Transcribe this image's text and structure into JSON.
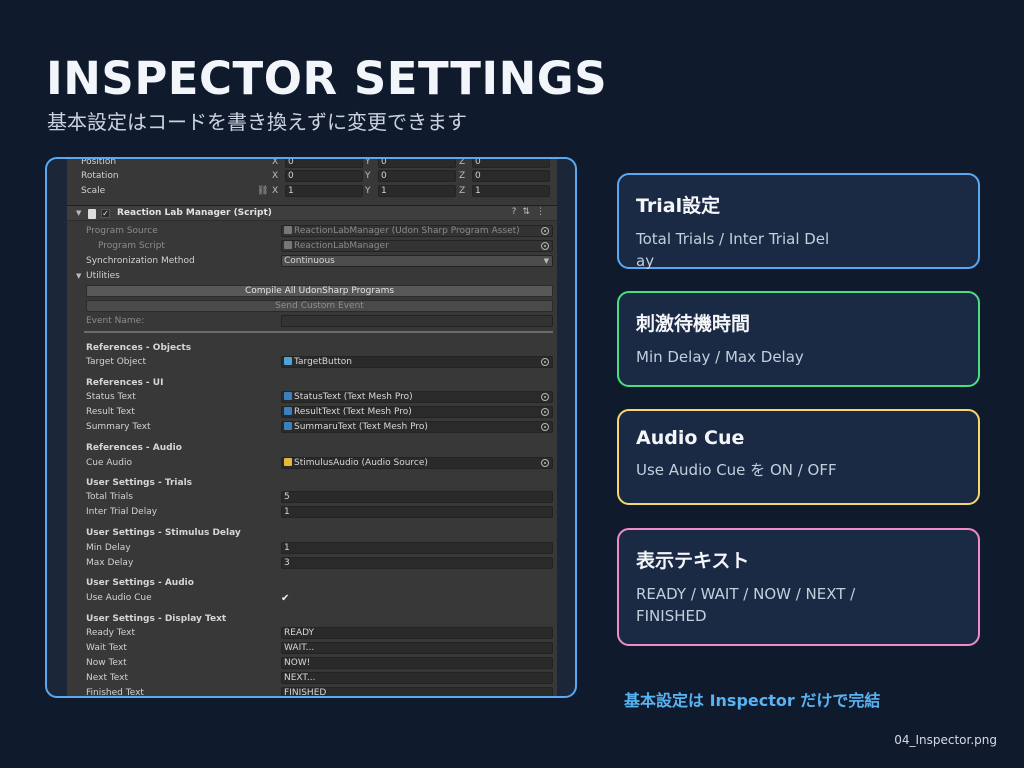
{
  "slide": {
    "title": "INSPECTOR SETTINGS",
    "subtitle": "基本設定はコードを書き換えずに変更できます",
    "footer_note": "基本設定は Inspector だけで完結",
    "file_name": "04_Inspector.png"
  },
  "colors": {
    "background": "#0f1b2d",
    "frame_border": "#5aa9f0",
    "card_trial": "#5aa9f0",
    "card_delay": "#4ade80",
    "card_audio": "#f5d76e",
    "card_text": "#f08cc8",
    "accent_text": "#59b2f2"
  },
  "inspector": {
    "transform": {
      "position_label": "Position",
      "rotation_label": "Rotation",
      "scale_label": "Scale",
      "axis_x": "X",
      "axis_y": "Y",
      "axis_z": "Z",
      "position": [
        "0",
        "0",
        "0"
      ],
      "rotation": [
        "0",
        "0",
        "0"
      ],
      "scale": [
        "1",
        "1",
        "1"
      ]
    },
    "component": {
      "title": "Reaction Lab Manager (Script)",
      "program_source_label": "Program Source",
      "program_source_value": "ReactionLabManager (Udon Sharp Program Asset)",
      "program_script_label": "Program Script",
      "program_script_value": "ReactionLabManager",
      "sync_label": "Synchronization Method",
      "sync_value": "Continuous",
      "utilities_label": "Utilities",
      "compile_button": "Compile All UdonSharp Programs",
      "send_event_button": "Send Custom Event",
      "event_name_label": "Event Name:"
    },
    "sections": {
      "objects": {
        "header": "References - Objects",
        "target_object_label": "Target Object",
        "target_object_value": "TargetButton"
      },
      "ui": {
        "header": "References - UI",
        "status_label": "Status Text",
        "status_value": "StatusText (Text Mesh Pro)",
        "result_label": "Result Text",
        "result_value": "ResultText (Text Mesh Pro)",
        "summary_label": "Summary Text",
        "summary_value": "SummaruText (Text Mesh Pro)"
      },
      "audio_ref": {
        "header": "References - Audio",
        "cue_label": "Cue Audio",
        "cue_value": "StimulusAudio (Audio Source)"
      },
      "trials": {
        "header": "User Settings - Trials",
        "total_label": "Total Trials",
        "total_value": "5",
        "inter_label": "Inter Trial Delay",
        "inter_value": "1"
      },
      "delay": {
        "header": "User Settings - Stimulus Delay",
        "min_label": "Min Delay",
        "min_value": "1",
        "max_label": "Max Delay",
        "max_value": "3"
      },
      "audio_settings": {
        "header": "User Settings - Audio",
        "use_label": "Use Audio Cue",
        "use_checked": true
      },
      "display": {
        "header": "User Settings - Display Text",
        "ready_label": "Ready Text",
        "ready_value": "READY",
        "wait_label": "Wait Text",
        "wait_value": "WAIT...",
        "now_label": "Now Text",
        "now_value": "NOW!",
        "next_label": "Next Text",
        "next_value": "NEXT...",
        "finished_label": "Finished Text",
        "finished_value": "FINISHED"
      }
    }
  },
  "cards": {
    "trial": {
      "title": "Trial設定",
      "desc": "Total Trials / Inter Trial Delay"
    },
    "delay": {
      "title": "刺激待機時間",
      "desc": "Min Delay / Max Delay"
    },
    "audio": {
      "title": "Audio Cue",
      "desc": "Use Audio Cue を ON / OFF"
    },
    "text": {
      "title": "表示テキスト",
      "desc": "READY / WAIT / NOW / NEXT / FINISHED"
    }
  }
}
